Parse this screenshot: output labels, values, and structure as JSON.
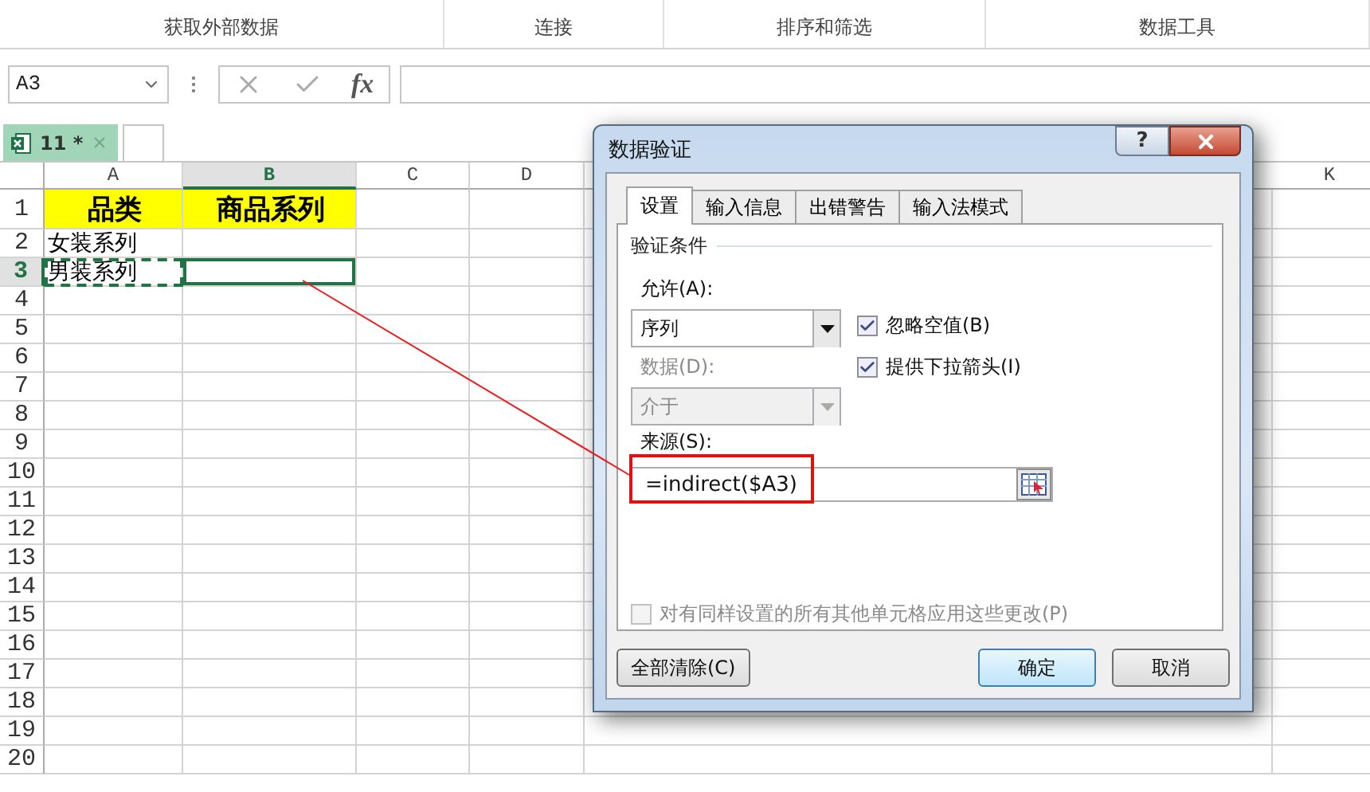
{
  "ribbon": {
    "groups": [
      "获取外部数据",
      "连接",
      "排序和筛选",
      "数据工具"
    ]
  },
  "formula_bar": {
    "name_box": "A3",
    "function_label": "fx"
  },
  "workbook_tabs": [
    {
      "label": "11 *",
      "selected": true
    }
  ],
  "sheet": {
    "columns": [
      {
        "label": "A",
        "selected": false
      },
      {
        "label": "B",
        "selected": true
      },
      {
        "label": "C",
        "selected": false
      },
      {
        "label": "D",
        "selected": false
      },
      {
        "label": "K",
        "selected": false
      }
    ],
    "rows": [
      {
        "label": "1",
        "selected": false,
        "cells": [
          {
            "kind": "header",
            "text": "品类",
            "selected": false,
            "copied": false
          },
          {
            "kind": "header",
            "text": "商品系列",
            "selected": false,
            "copied": false
          }
        ]
      },
      {
        "label": "2",
        "selected": false,
        "cells": [
          {
            "kind": "plain",
            "text": "女装系列",
            "selected": false,
            "copied": false
          }
        ]
      },
      {
        "label": "3",
        "selected": true,
        "cells": [
          {
            "kind": "plain",
            "text": "男装系列",
            "selected": false,
            "copied": true
          },
          {
            "kind": "plain",
            "selected": true,
            "copied": false
          }
        ]
      },
      {
        "label": "4",
        "selected": false
      },
      {
        "label": "5",
        "selected": false
      },
      {
        "label": "6",
        "selected": false
      },
      {
        "label": "7",
        "selected": false
      },
      {
        "label": "8",
        "selected": false
      },
      {
        "label": "9",
        "selected": false
      },
      {
        "label": "10",
        "selected": false
      },
      {
        "label": "11",
        "selected": false
      },
      {
        "label": "12",
        "selected": false
      },
      {
        "label": "13",
        "selected": false
      },
      {
        "label": "14",
        "selected": false
      },
      {
        "label": "15",
        "selected": false
      },
      {
        "label": "16",
        "selected": false
      },
      {
        "label": "17",
        "selected": false
      },
      {
        "label": "18",
        "selected": false
      },
      {
        "label": "19",
        "selected": false
      },
      {
        "label": "20",
        "selected": false
      }
    ]
  },
  "dialog": {
    "title": "数据验证",
    "help": "?",
    "tabs": [
      {
        "label": "设置",
        "selected": true
      },
      {
        "label": "输入信息",
        "selected": false
      },
      {
        "label": "出错警告",
        "selected": false
      },
      {
        "label": "输入法模式",
        "selected": false
      }
    ],
    "section": "验证条件",
    "allow": {
      "label": "允许(A):",
      "value": "序列",
      "disabled": false
    },
    "data": {
      "label": "数据(D):",
      "value": "介于",
      "disabled": true
    },
    "checkboxes": [
      {
        "label": "忽略空值(B)",
        "checked": true,
        "disabled": false
      },
      {
        "label": "提供下拉箭头(I)",
        "checked": true,
        "disabled": false
      }
    ],
    "source": {
      "label": "来源(S):",
      "value": "=indirect($A3)"
    },
    "apply_all": {
      "label": "对有同样设置的所有其他单元格应用这些更改(P)",
      "checked": false,
      "disabled": true
    },
    "buttons": [
      {
        "label": "全部清除(C)",
        "kind": "clear",
        "default": false
      },
      {
        "label": "确定",
        "kind": "ok",
        "default": true
      },
      {
        "label": "取消",
        "kind": "cancel",
        "default": false
      }
    ]
  }
}
